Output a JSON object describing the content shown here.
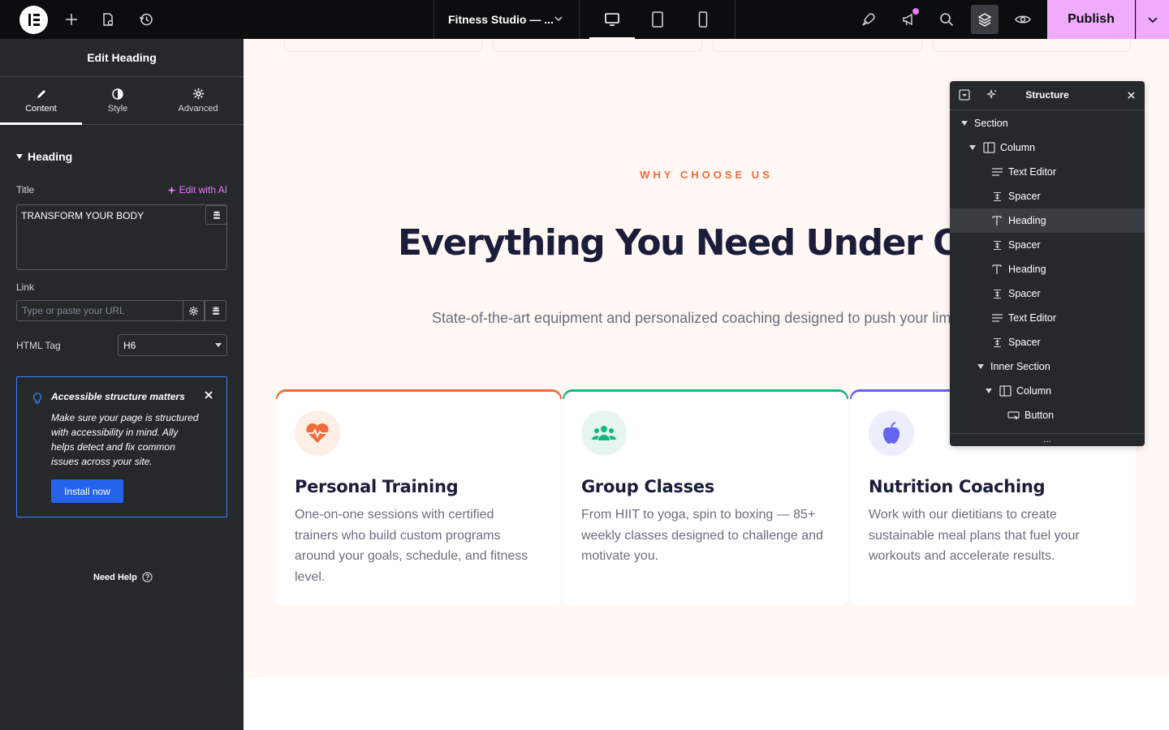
{
  "topbar": {
    "document_title": "Fitness Studio — ...",
    "publish_label": "Publish"
  },
  "panel": {
    "header": "Edit Heading",
    "tabs": [
      {
        "label": "Content",
        "icon": "pencil-icon"
      },
      {
        "label": "Style",
        "icon": "half-circle-icon"
      },
      {
        "label": "Advanced",
        "icon": "gear-icon"
      }
    ],
    "section_title": "Heading",
    "title_label": "Title",
    "edit_ai_label": "Edit with AI",
    "title_value": "TRANSFORM YOUR BODY",
    "link_label": "Link",
    "link_placeholder": "Type or paste your URL",
    "html_tag_label": "HTML Tag",
    "html_tag_value": "H6",
    "notice": {
      "title": "Accessible structure matters",
      "text": "Make sure your page is structured with accessibility in mind. Ally helps detect and fix common issues across your site.",
      "button": "Install now"
    },
    "need_help": "Need Help"
  },
  "canvas": {
    "eyebrow": "WHY CHOOSE US",
    "heading": "Everything You Need Under One Roof",
    "subheading": "State-of-the-art equipment and personalized coaching designed to push your limits",
    "cards": [
      {
        "title": "Personal Training",
        "text": "One-on-one sessions with certified trainers who build custom programs around your goals, schedule, and fitness level.",
        "icon": "heartbeat-icon",
        "accent": "#f26b3a",
        "icon_bg": "#fdeee6"
      },
      {
        "title": "Group Classes",
        "text": "From HIIT to yoga, spin to boxing — 85+ weekly classes designed to challenge and motivate you.",
        "icon": "users-icon",
        "accent": "#10b981",
        "icon_bg": "#e6f6ef"
      },
      {
        "title": "Nutrition Coaching",
        "text": "Work with our dietitians to create sustainable meal plans that fuel your workouts and accelerate results.",
        "icon": "apple-icon",
        "accent": "#6366f1",
        "icon_bg": "#eceefd"
      }
    ]
  },
  "structure": {
    "title": "Structure",
    "items": [
      {
        "label": "Section",
        "type": "section",
        "depth": 0
      },
      {
        "label": "Column",
        "type": "column",
        "depth": 1
      },
      {
        "label": "Text Editor",
        "type": "text-editor",
        "depth": 2
      },
      {
        "label": "Spacer",
        "type": "spacer",
        "depth": 2
      },
      {
        "label": "Heading",
        "type": "heading",
        "depth": 2,
        "selected": true
      },
      {
        "label": "Spacer",
        "type": "spacer",
        "depth": 2
      },
      {
        "label": "Heading",
        "type": "heading",
        "depth": 2
      },
      {
        "label": "Spacer",
        "type": "spacer",
        "depth": 2
      },
      {
        "label": "Text Editor",
        "type": "text-editor",
        "depth": 2
      },
      {
        "label": "Spacer",
        "type": "spacer",
        "depth": 2
      },
      {
        "label": "Inner Section",
        "type": "inner-section",
        "depth": 2
      },
      {
        "label": "Column",
        "type": "column",
        "depth": 3
      },
      {
        "label": "Button",
        "type": "button",
        "depth": 4
      }
    ],
    "more": "..."
  },
  "colors": {
    "editor_dark": "#26292c",
    "topbar": "#0c0d0e",
    "publish": "#f0abfc",
    "accent_orange": "#f26b3a",
    "heading_navy": "#1b1d3a"
  }
}
